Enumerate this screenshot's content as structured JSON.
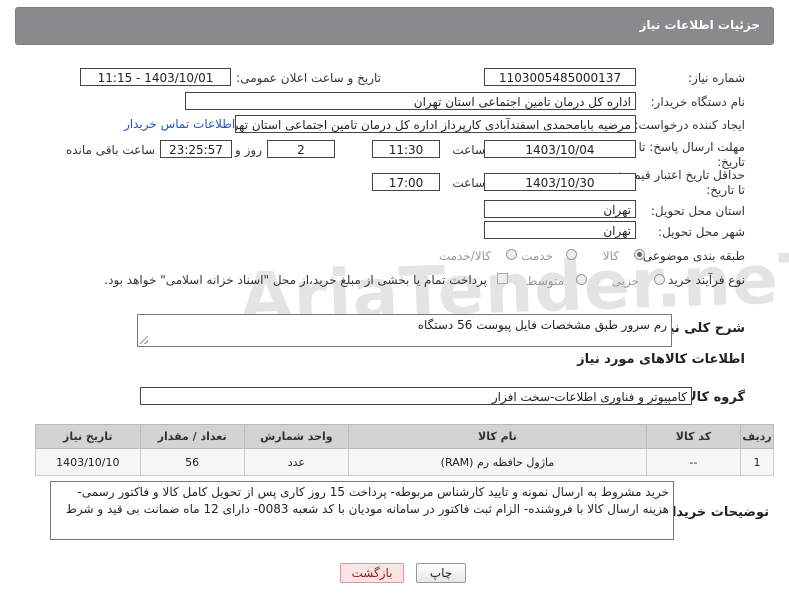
{
  "header": {
    "title": "جزئیات اطلاعات نیاز"
  },
  "need_number": {
    "label": "شماره نیاز:",
    "value": "1103005485000137"
  },
  "announce_datetime": {
    "label": "تاریخ و ساعت اعلان عمومی:",
    "value": "1403/10/01 - 11:15"
  },
  "buyer_org": {
    "label": "نام دستگاه خریدار:",
    "value": "اداره کل درمان تامین اجتماعی استان تهران"
  },
  "requester": {
    "label": "ایجاد کننده درخواست:",
    "value": "مرضیه بابامحمدی اسفندآبادی کارپرداز اداره کل درمان تامین اجتماعی استان تهران",
    "contact_link": "اطلاعات تماس خریدار"
  },
  "reply_deadline": {
    "label": "مهلت ارسال پاسخ: تا تاریخ:",
    "date": "1403/10/04",
    "time_label": "ساعت",
    "time": "11:30",
    "days": "2",
    "days_label": "روز و",
    "remaining": "23:25:57",
    "remaining_label": "ساعت باقی مانده"
  },
  "price_validity": {
    "label": "حداقل تاریخ اعتبار قیمت: تا تاریخ:",
    "date": "1403/10/30",
    "time_label": "ساعت",
    "time": "17:00"
  },
  "delivery_province": {
    "label": "استان محل تحویل:",
    "value": "تهران"
  },
  "delivery_city": {
    "label": "شهر محل تحویل:",
    "value": "تهران"
  },
  "subject_category": {
    "label": "طبقه بندی موضوعی:",
    "options": [
      "کالا",
      "خدمت",
      "کالا/خدمت"
    ],
    "selected": "کالا"
  },
  "purchase_process": {
    "label": "نوع فرآیند خرید :",
    "options": [
      "جزیی",
      "متوسط"
    ],
    "selected": "",
    "payment_note": "پرداخت تمام یا بخشی از مبلغ خرید،از محل \"اسناد خزانه اسلامی\" خواهد بود."
  },
  "general_description": {
    "label": "شرح کلی نیاز:",
    "value": "رم سرور طبق مشخصات فایل پیوست 56 دستگاه"
  },
  "goods_info": {
    "title": "اطلاعات کالاهای مورد نیاز"
  },
  "goods_group": {
    "label": "گروه کالا:",
    "value": "کامپیوتر و فناوری اطلاعات-سخت افزار"
  },
  "items_table": {
    "columns": [
      "ردیف",
      "کد کالا",
      "نام کالا",
      "واحد شمارش",
      "تعداد / مقدار",
      "تاریخ نیاز"
    ],
    "rows": [
      [
        "1",
        "--",
        "ماژول حافظه رم (RAM)",
        "عدد",
        "56",
        "1403/10/10"
      ]
    ]
  },
  "buyer_notes": {
    "label": "توضیحات خریدار:",
    "value": "خرید مشروط به ارسال نمونه و تایید کارشناس مربوطه- پرداخت 15 روز کاری پس از تحویل کامل کالا و فاکتور رسمی- هزینه ارسال کالا با فروشنده- الزام ثبت فاکتور در سامانه مودیان با کد شعبه 0083- دارای 12 ماه ضمانت بی قید و شرط"
  },
  "buttons": {
    "print": "چاپ",
    "back": "بازگشت"
  },
  "watermark": "AriaTender.neT"
}
